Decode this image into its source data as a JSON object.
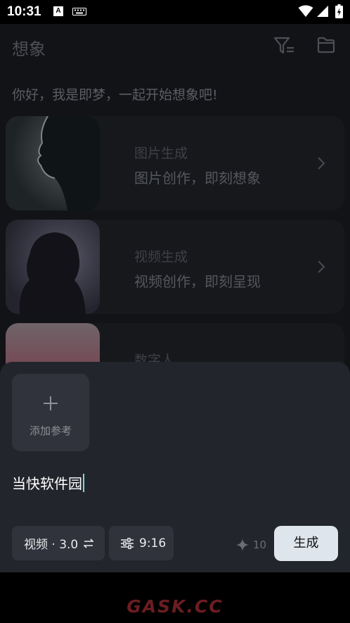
{
  "status_bar": {
    "time": "10:31",
    "notification_badge": "A",
    "icons": [
      "keyboard-icon",
      "wifi-icon",
      "signal-icon",
      "battery-charging-icon"
    ]
  },
  "header": {
    "title": "想象",
    "icons": [
      "filter-icon",
      "folder-icon"
    ]
  },
  "greeting": "你好，我是即梦，一起开始想象吧!",
  "cards": [
    {
      "title": "图片生成",
      "subtitle": "图片创作，即刻想象"
    },
    {
      "title": "视频生成",
      "subtitle": "视频创作，即刻呈现"
    },
    {
      "title": "数字人"
    }
  ],
  "sheet": {
    "add_reference_label": "添加参考",
    "prompt_value": "当快软件园",
    "model_chip": "视频 · 3.0",
    "ratio_chip": "9:16",
    "credits": "10",
    "generate_label": "生成"
  },
  "watermark": "GASK.CC",
  "colors": {
    "sheet_bg": "#23252d",
    "chip_bg": "#30333b",
    "generate_bg": "#dfe5ec",
    "caret": "#7ed8d0"
  }
}
